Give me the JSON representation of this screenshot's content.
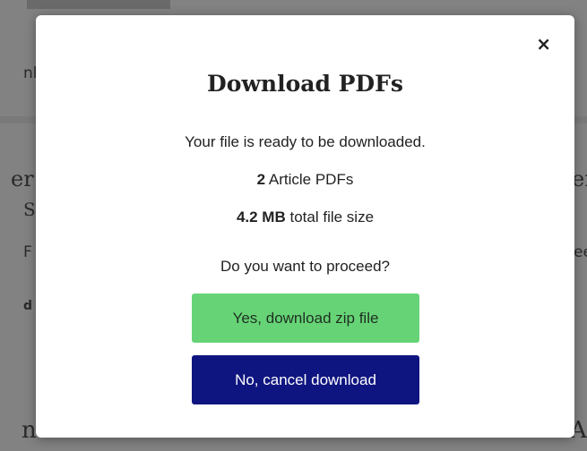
{
  "modal": {
    "title": "Download PDFs",
    "close_label": "×",
    "ready_text": "Your file is ready to be downloaded.",
    "count_value": "2",
    "count_label": "Article PDFs",
    "size_value": "4.2 MB",
    "size_label": "total file size",
    "question": "Do you want to proceed?",
    "confirm_label": "Yes, download zip file",
    "cancel_label": "No, cancel download"
  },
  "colors": {
    "confirm_bg": "#66d476",
    "cancel_bg": "#0f1580",
    "overlay": "#828282"
  },
  "background": {
    "frag_1": "nl",
    "frag_2": "er",
    "frag_3": "S",
    "frag_4": "F",
    "frag_5": "d",
    "frag_6": "er",
    "frag_7": "ee",
    "frag_8": "n",
    "frag_9": "A"
  }
}
